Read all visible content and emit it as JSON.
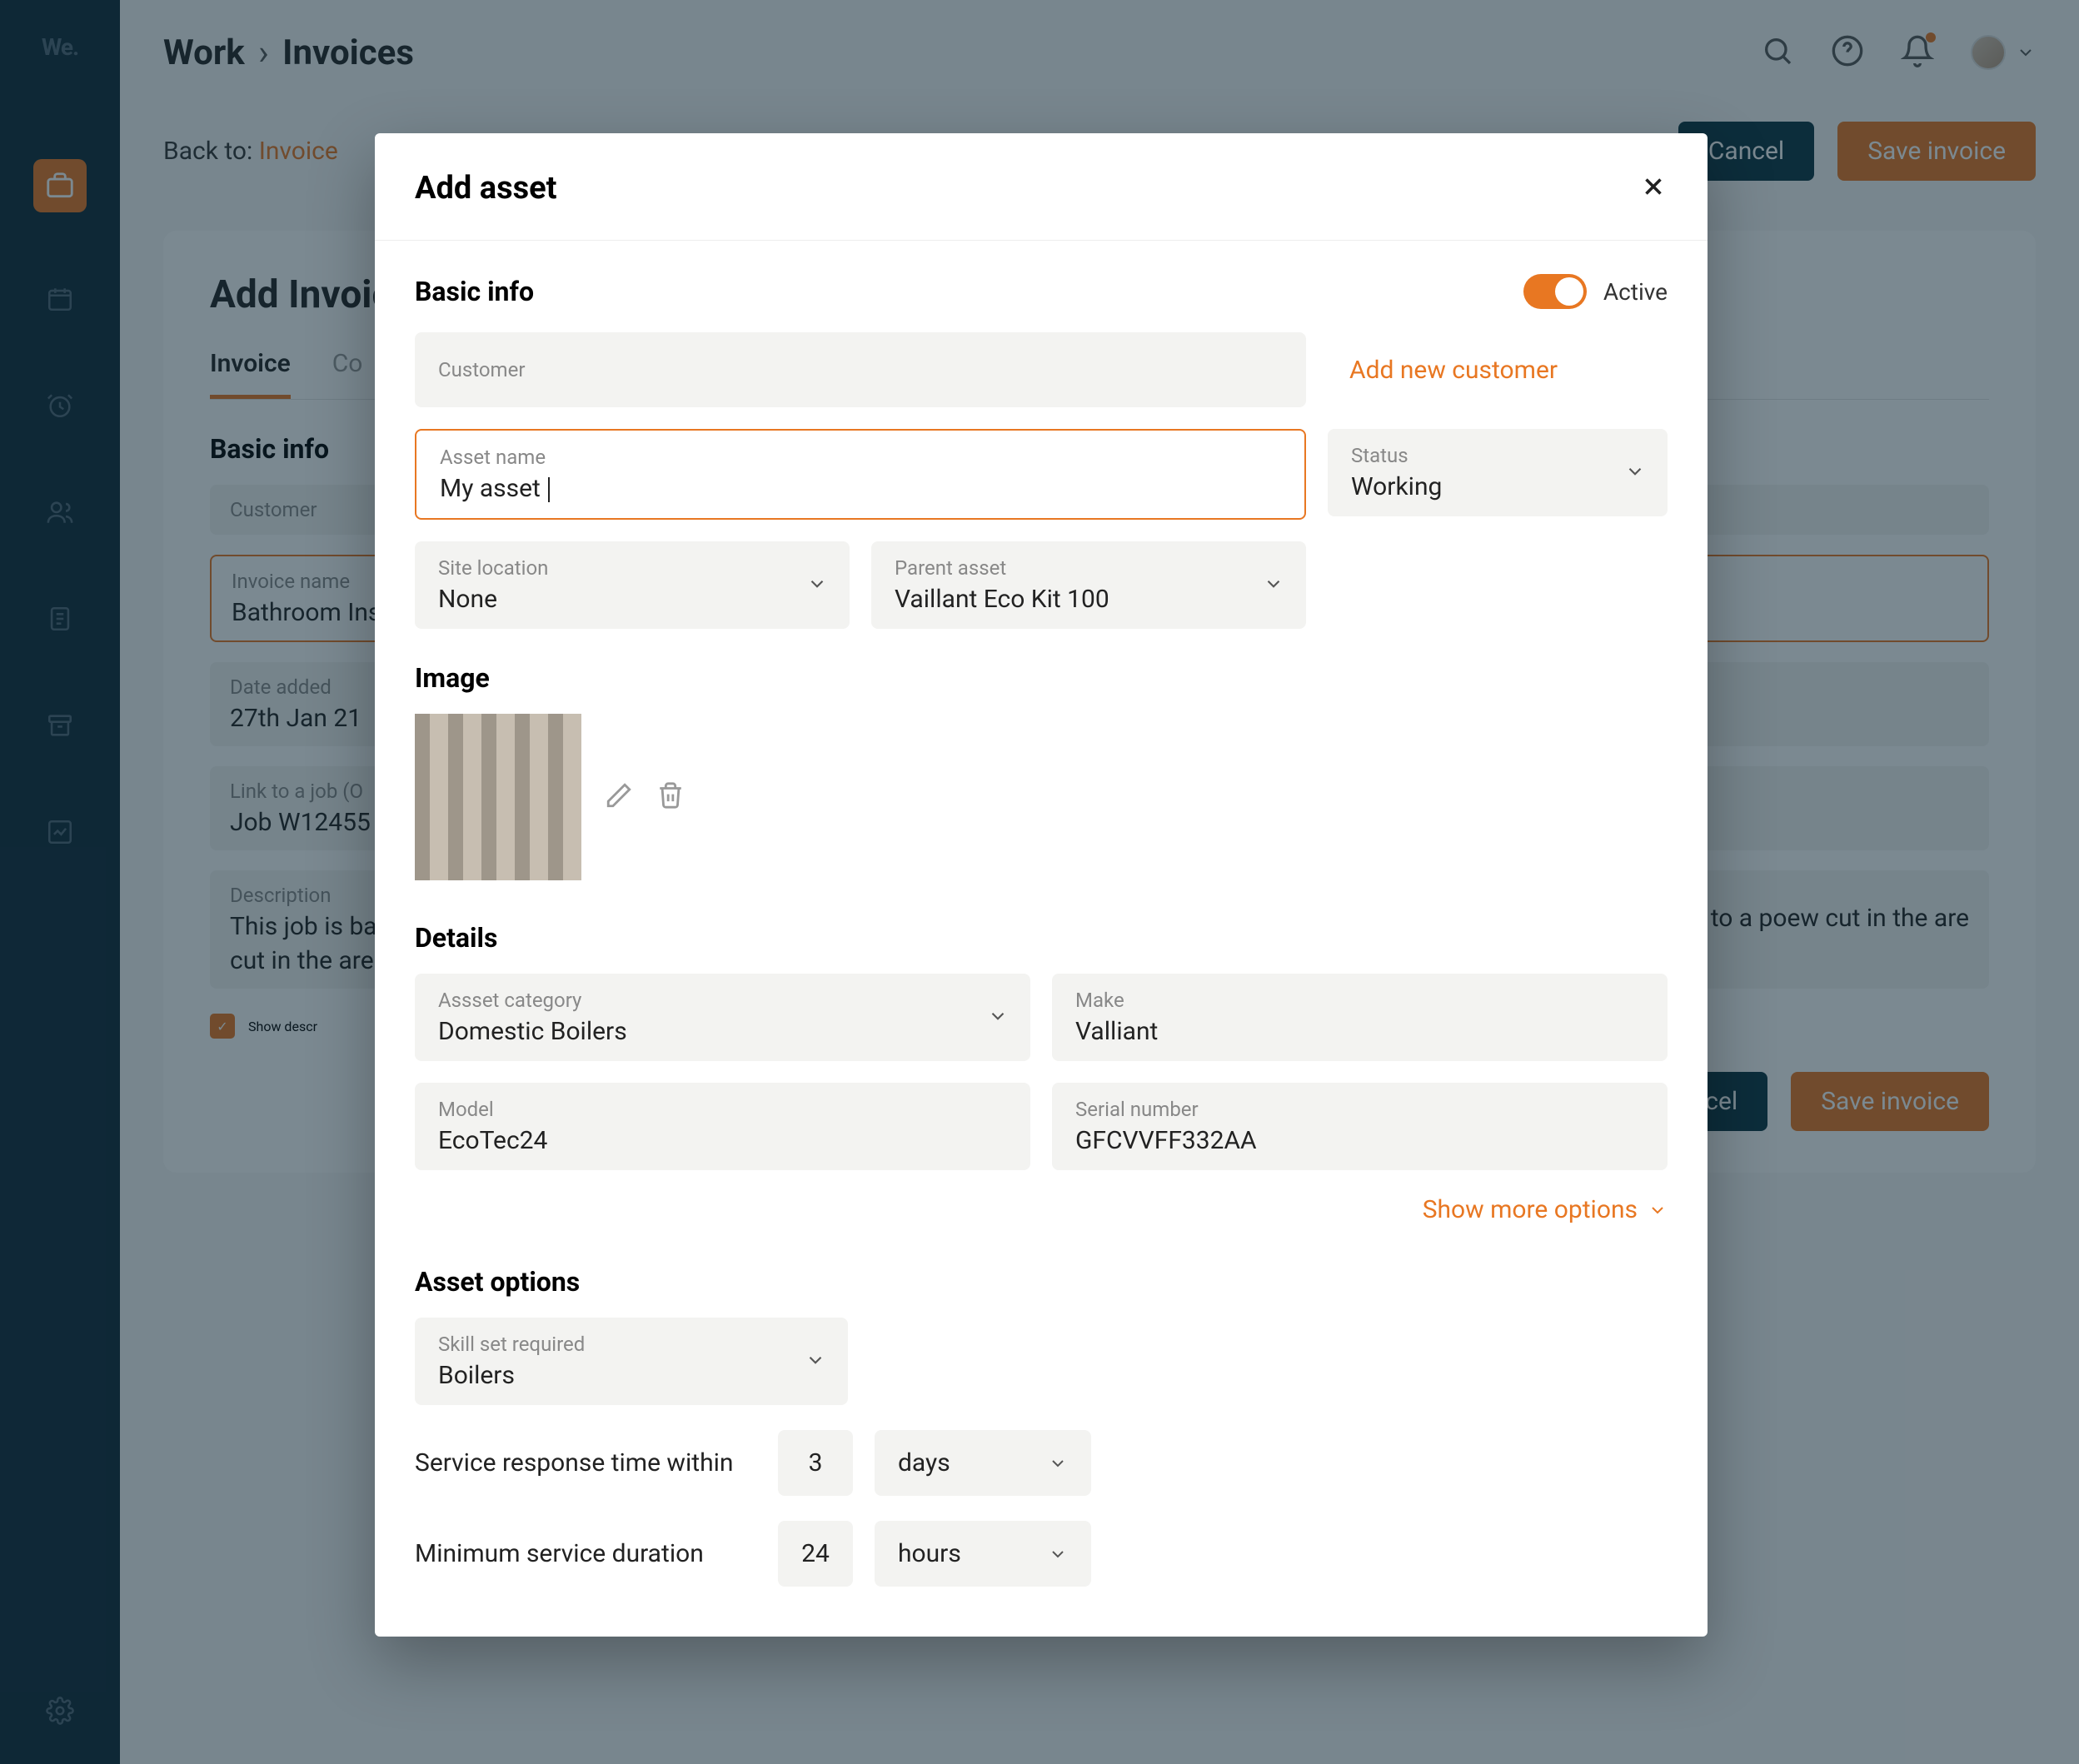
{
  "app": {
    "logo": "We."
  },
  "breadcrumb": {
    "part1": "Work",
    "part2": "Invoices"
  },
  "backto": {
    "label": "Back to:",
    "link": "Invoice"
  },
  "topActions": {
    "cancel": "Cancel",
    "save": "Save invoice"
  },
  "page": {
    "title": "Add Invoice",
    "tabs": {
      "invoice": "Invoice",
      "co": "Co"
    },
    "basicInfo": "Basic info",
    "customer_label": "Customer",
    "invoice_name_label": "Invoice name",
    "invoice_name_value": "Bathroom Ins",
    "date_added_label": "Date added",
    "date_added_value": "27th Jan 21",
    "link_job_label": "Link to a job (O",
    "link_job_value": "Job W12455",
    "description_label": "Description",
    "description_value": "This job is ba",
    "description_tail": "thing related to a poew cut in the are",
    "show_desc": "Show descr",
    "bottomCancel": "cel",
    "bottomSave": "Save invoice"
  },
  "modal": {
    "title": "Add asset",
    "section_basic": "Basic info",
    "active_label": "Active",
    "customer_label": "Customer",
    "add_customer": "Add new customer",
    "asset_name_label": "Asset name",
    "asset_name_value": "My asset ",
    "status_label": "Status",
    "status_value": "Working",
    "site_label": "Site location",
    "site_value": "None",
    "parent_label": "Parent asset",
    "parent_value": "Vaillant Eco Kit 100",
    "image_section": "Image",
    "details_section": "Details",
    "category_label": "Assset category",
    "category_value": "Domestic Boilers",
    "make_label": "Make",
    "make_value": "Valliant",
    "model_label": "Model",
    "model_value": "EcoTec24",
    "serial_label": "Serial number",
    "serial_value": "GFCVVFF332AA",
    "show_more": "Show more options",
    "options_section": "Asset options",
    "skill_label": "Skill set required",
    "skill_value": "Boilers",
    "response_label": "Service response time within",
    "response_value": "3",
    "response_unit": "days",
    "duration_label": "Minimum service duration",
    "duration_value": "24",
    "duration_unit": "hours"
  }
}
